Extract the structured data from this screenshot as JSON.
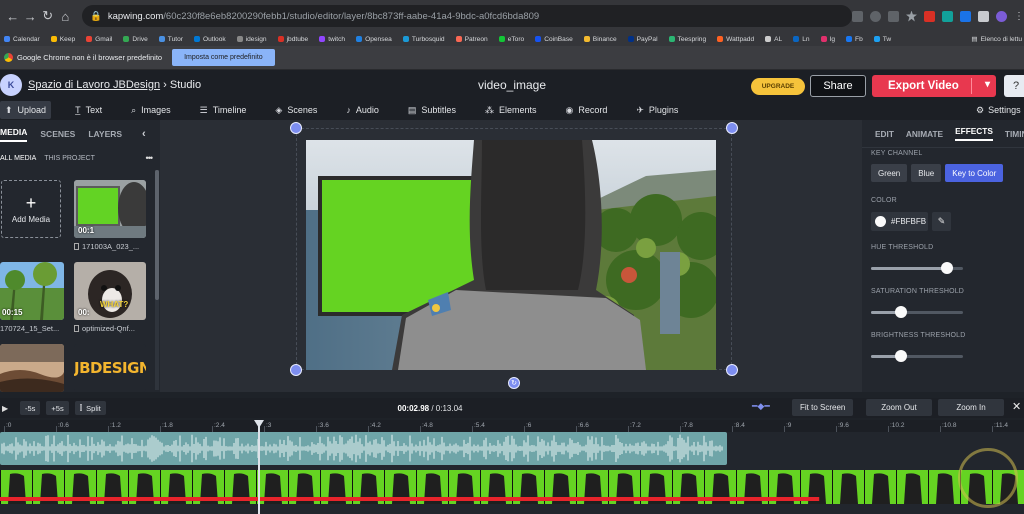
{
  "browser": {
    "url_host": "kapwing.com",
    "url_path": "/60c230f8e6eb8200290febb1/studio/editor/layer/8bc873ff-aabe-41a4-9bdc-a0fcd6bda809",
    "bookmarks": [
      "Calendar",
      "Keep",
      "Gmail",
      "Drive",
      "Tutor",
      "Outlook",
      "idesign",
      "jbdtube",
      "twitch",
      "Opensea",
      "Turbosquid",
      "Patreon",
      "eToro",
      "CoinBase",
      "Binance",
      "PayPal",
      "Teespring",
      "Wattpadd",
      "AL",
      "Ln",
      "Ig",
      "Fb",
      "Tw"
    ],
    "bookmark_colors": [
      "#4285f4",
      "#fbbc05",
      "#ea4335",
      "#34a853",
      "#4a90e2",
      "#0078d4",
      "#888888",
      "#d93025",
      "#9146ff",
      "#2081e2",
      "#1b9ad6",
      "#f96854",
      "#13c636",
      "#1652f0",
      "#f3ba2f",
      "#003087",
      "#2bb673",
      "#ff6122",
      "#cccccc",
      "#0a66c2",
      "#e1306c",
      "#1877f2",
      "#1da1f2"
    ],
    "reading_list": "Elenco di lettu",
    "infobar_message": "Google Chrome non è il browser predefinito",
    "infobar_button": "Imposta come predefinito"
  },
  "app": {
    "logo": "K",
    "workspace": "Spazio di Lavoro JBDesign",
    "crumb_sep": "›",
    "crumb_current": "Studio",
    "doc_title": "video_image",
    "upgrade": "UPGRADE",
    "share": "Share",
    "export": "Export Video",
    "help_icon": "?"
  },
  "toolbar": [
    {
      "label": "Upload",
      "icon": "⬆",
      "active": true
    },
    {
      "label": "Text",
      "icon": "T̲"
    },
    {
      "label": "Images",
      "icon": "⌕"
    },
    {
      "label": "Timeline",
      "icon": "☰"
    },
    {
      "label": "Scenes",
      "icon": "◈"
    },
    {
      "label": "Audio",
      "icon": "♪"
    },
    {
      "label": "Subtitles",
      "icon": "▤"
    },
    {
      "label": "Elements",
      "icon": "⁂"
    },
    {
      "label": "Record",
      "icon": "◉"
    },
    {
      "label": "Plugins",
      "icon": "✈"
    }
  ],
  "settings_label": "Settings",
  "left_panel": {
    "tabs": [
      "MEDIA",
      "SCENES",
      "LAYERS"
    ],
    "subtabs": [
      "ALL MEDIA",
      "THIS PROJECT"
    ],
    "more": "•••",
    "add_media": "Add Media",
    "add_plus": "+",
    "thumb_captions": [
      "171003A_023_...",
      "170724_15_Set...",
      "optimized-Qnf..."
    ],
    "durations": [
      "00:1",
      "00:15",
      "00:"
    ],
    "thumb_texts": [
      "WHAT?",
      "JBDESIGN"
    ]
  },
  "right_panel": {
    "tabs": [
      "EDIT",
      "ANIMATE",
      "EFFECTS",
      "TIMING"
    ],
    "active_tab": "EFFECTS",
    "key_channel_label": "KEY CHANNEL",
    "key_options": [
      "Green",
      "Blue",
      "Key to Color"
    ],
    "key_selected": "Key to Color",
    "color_label": "COLOR",
    "color_value": "#FBFBFB",
    "hue_label": "HUE THRESHOLD",
    "hue_value": 0.83,
    "saturation_label": "SATURATION THRESHOLD",
    "saturation_value": 0.33,
    "brightness_label": "BRIGHTNESS THRESHOLD",
    "brightness_value": 0.33
  },
  "timeline": {
    "back": "-5s",
    "fwd": "+5s",
    "split": "Split",
    "current": "00:02.98",
    "total": "0:13.04",
    "fit": "Fit to Screen",
    "zoom_out": "Zoom Out",
    "zoom_in": "Zoom In",
    "close": "✕",
    "ruler": [
      ":0",
      ":0.6",
      ":1.2",
      ":1.8",
      ":2.4",
      ":3",
      ":3.6",
      ":4.2",
      ":4.8",
      ":5.4",
      ":6",
      ":6.6",
      ":7.2",
      ":7.8",
      ":8.4",
      ":9",
      ":9.6",
      ":10.2",
      ":10.8",
      ":11.4"
    ],
    "audio_fraction": 0.71,
    "progress_fraction": 0.8
  },
  "colors": {
    "accent": "#4b63e0",
    "export": "#e8384f",
    "upgrade": "#f6c33b",
    "green_screen": "#65d322",
    "audio_track": "#6fa5a8",
    "progress": "#e8242b"
  }
}
